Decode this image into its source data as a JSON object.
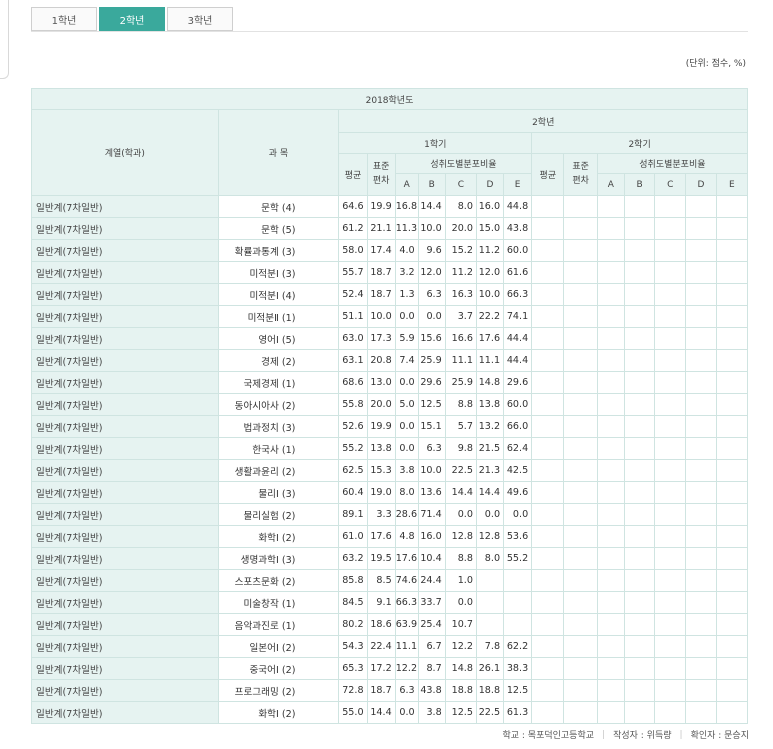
{
  "tabs": [
    {
      "label": "1학년",
      "active": false
    },
    {
      "label": "2학년",
      "active": true
    },
    {
      "label": "3학년",
      "active": false
    }
  ],
  "unit_note": "(단위: 점수, %)",
  "table": {
    "year_header": "2018학년도",
    "grade_header": "2학년",
    "col_dept": "계열(학과)",
    "col_subject": "과 목",
    "semester1": "1학기",
    "semester2": "2학기",
    "avg": "평균",
    "std_top": "표준",
    "std_bottom": "편차",
    "dist": "성취도별분포비율",
    "grades": [
      "A",
      "B",
      "C",
      "D",
      "E"
    ],
    "rows": [
      {
        "dept": "일반계(7차일반)",
        "subject": "문학 (4)",
        "avg": "64.6",
        "std": "19.9",
        "a": "16.8",
        "b": "14.4",
        "c": "8.0",
        "d": "16.0",
        "e": "44.8"
      },
      {
        "dept": "일반계(7차일반)",
        "subject": "문학 (5)",
        "avg": "61.2",
        "std": "21.1",
        "a": "11.3",
        "b": "10.0",
        "c": "20.0",
        "d": "15.0",
        "e": "43.8"
      },
      {
        "dept": "일반계(7차일반)",
        "subject": "확률과통계 (3)",
        "avg": "58.0",
        "std": "17.4",
        "a": "4.0",
        "b": "9.6",
        "c": "15.2",
        "d": "11.2",
        "e": "60.0"
      },
      {
        "dept": "일반계(7차일반)",
        "subject": "미적분Ⅰ (3)",
        "avg": "55.7",
        "std": "18.7",
        "a": "3.2",
        "b": "12.0",
        "c": "11.2",
        "d": "12.0",
        "e": "61.6"
      },
      {
        "dept": "일반계(7차일반)",
        "subject": "미적분Ⅰ (4)",
        "avg": "52.4",
        "std": "18.7",
        "a": "1.3",
        "b": "6.3",
        "c": "16.3",
        "d": "10.0",
        "e": "66.3"
      },
      {
        "dept": "일반계(7차일반)",
        "subject": "미적분Ⅱ (1)",
        "avg": "51.1",
        "std": "10.0",
        "a": "0.0",
        "b": "0.0",
        "c": "3.7",
        "d": "22.2",
        "e": "74.1"
      },
      {
        "dept": "일반계(7차일반)",
        "subject": "영어Ⅰ (5)",
        "avg": "63.0",
        "std": "17.3",
        "a": "5.9",
        "b": "15.6",
        "c": "16.6",
        "d": "17.6",
        "e": "44.4"
      },
      {
        "dept": "일반계(7차일반)",
        "subject": "경제 (2)",
        "avg": "63.1",
        "std": "20.8",
        "a": "7.4",
        "b": "25.9",
        "c": "11.1",
        "d": "11.1",
        "e": "44.4"
      },
      {
        "dept": "일반계(7차일반)",
        "subject": "국제경제 (1)",
        "avg": "68.6",
        "std": "13.0",
        "a": "0.0",
        "b": "29.6",
        "c": "25.9",
        "d": "14.8",
        "e": "29.6"
      },
      {
        "dept": "일반계(7차일반)",
        "subject": "동아시아사 (2)",
        "avg": "55.8",
        "std": "20.0",
        "a": "5.0",
        "b": "12.5",
        "c": "8.8",
        "d": "13.8",
        "e": "60.0"
      },
      {
        "dept": "일반계(7차일반)",
        "subject": "법과정치 (3)",
        "avg": "52.6",
        "std": "19.9",
        "a": "0.0",
        "b": "15.1",
        "c": "5.7",
        "d": "13.2",
        "e": "66.0"
      },
      {
        "dept": "일반계(7차일반)",
        "subject": "한국사 (1)",
        "avg": "55.2",
        "std": "13.8",
        "a": "0.0",
        "b": "6.3",
        "c": "9.8",
        "d": "21.5",
        "e": "62.4"
      },
      {
        "dept": "일반계(7차일반)",
        "subject": "생활과윤리 (2)",
        "avg": "62.5",
        "std": "15.3",
        "a": "3.8",
        "b": "10.0",
        "c": "22.5",
        "d": "21.3",
        "e": "42.5"
      },
      {
        "dept": "일반계(7차일반)",
        "subject": "물리Ⅰ (3)",
        "avg": "60.4",
        "std": "19.0",
        "a": "8.0",
        "b": "13.6",
        "c": "14.4",
        "d": "14.4",
        "e": "49.6"
      },
      {
        "dept": "일반계(7차일반)",
        "subject": "물리실험 (2)",
        "avg": "89.1",
        "std": "3.3",
        "a": "28.6",
        "b": "71.4",
        "c": "0.0",
        "d": "0.0",
        "e": "0.0"
      },
      {
        "dept": "일반계(7차일반)",
        "subject": "화학Ⅰ (2)",
        "avg": "61.0",
        "std": "17.6",
        "a": "4.8",
        "b": "16.0",
        "c": "12.8",
        "d": "12.8",
        "e": "53.6"
      },
      {
        "dept": "일반계(7차일반)",
        "subject": "생명과학Ⅰ (3)",
        "avg": "63.2",
        "std": "19.5",
        "a": "17.6",
        "b": "10.4",
        "c": "8.8",
        "d": "8.0",
        "e": "55.2"
      },
      {
        "dept": "일반계(7차일반)",
        "subject": "스포츠문화 (2)",
        "avg": "85.8",
        "std": "8.5",
        "a": "74.6",
        "b": "24.4",
        "c": "1.0",
        "d": "",
        "e": ""
      },
      {
        "dept": "일반계(7차일반)",
        "subject": "미술창작 (1)",
        "avg": "84.5",
        "std": "9.1",
        "a": "66.3",
        "b": "33.7",
        "c": "0.0",
        "d": "",
        "e": ""
      },
      {
        "dept": "일반계(7차일반)",
        "subject": "음악과진로 (1)",
        "avg": "80.2",
        "std": "18.6",
        "a": "63.9",
        "b": "25.4",
        "c": "10.7",
        "d": "",
        "e": ""
      },
      {
        "dept": "일반계(7차일반)",
        "subject": "일본어Ⅰ (2)",
        "avg": "54.3",
        "std": "22.4",
        "a": "11.1",
        "b": "6.7",
        "c": "12.2",
        "d": "7.8",
        "e": "62.2"
      },
      {
        "dept": "일반계(7차일반)",
        "subject": "중국어Ⅰ (2)",
        "avg": "65.3",
        "std": "17.2",
        "a": "12.2",
        "b": "8.7",
        "c": "14.8",
        "d": "26.1",
        "e": "38.3"
      },
      {
        "dept": "일반계(7차일반)",
        "subject": "프로그래밍 (2)",
        "avg": "72.8",
        "std": "18.7",
        "a": "6.3",
        "b": "43.8",
        "c": "18.8",
        "d": "18.8",
        "e": "12.5"
      },
      {
        "dept": "일반계(7차일반)",
        "subject": "화학Ⅰ (2)",
        "avg": "55.0",
        "std": "14.4",
        "a": "0.0",
        "b": "3.8",
        "c": "12.5",
        "d": "22.5",
        "e": "61.3"
      }
    ]
  },
  "footer": {
    "school": "학교 : 목포덕인고등학교",
    "author": "작성자 : 위득량",
    "checker": "확인자 : 문승지"
  }
}
